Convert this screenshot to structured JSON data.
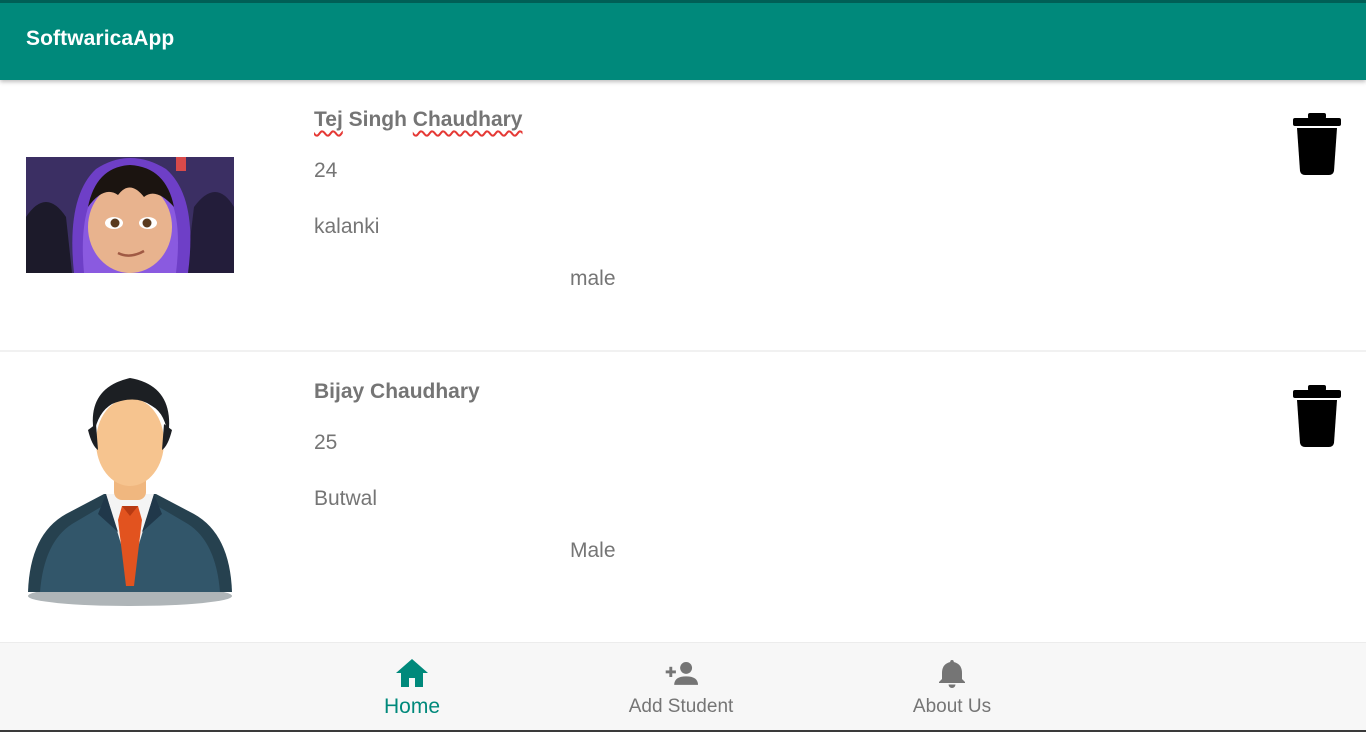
{
  "app": {
    "title": "SoftwaricaApp",
    "accent_color": "#00897b"
  },
  "students": [
    {
      "name_parts": [
        "Tej",
        " Singh ",
        "Chaudhary"
      ],
      "age": "24",
      "address": "kalanki",
      "gender": "male",
      "avatar_icon": "cartoon-avatar-icon",
      "delete_icon": "trash-icon"
    },
    {
      "name": "Bijay Chaudhary",
      "age": "25",
      "address": "Butwal",
      "gender": "Male",
      "avatar_icon": "businessman-avatar-icon",
      "delete_icon": "trash-icon"
    }
  ],
  "bottom_nav": {
    "items": [
      {
        "label": "Home",
        "icon": "home-icon",
        "active": true
      },
      {
        "label": "Add Student",
        "icon": "person-add-icon",
        "active": false
      },
      {
        "label": "About Us",
        "icon": "bell-icon",
        "active": false
      }
    ]
  }
}
